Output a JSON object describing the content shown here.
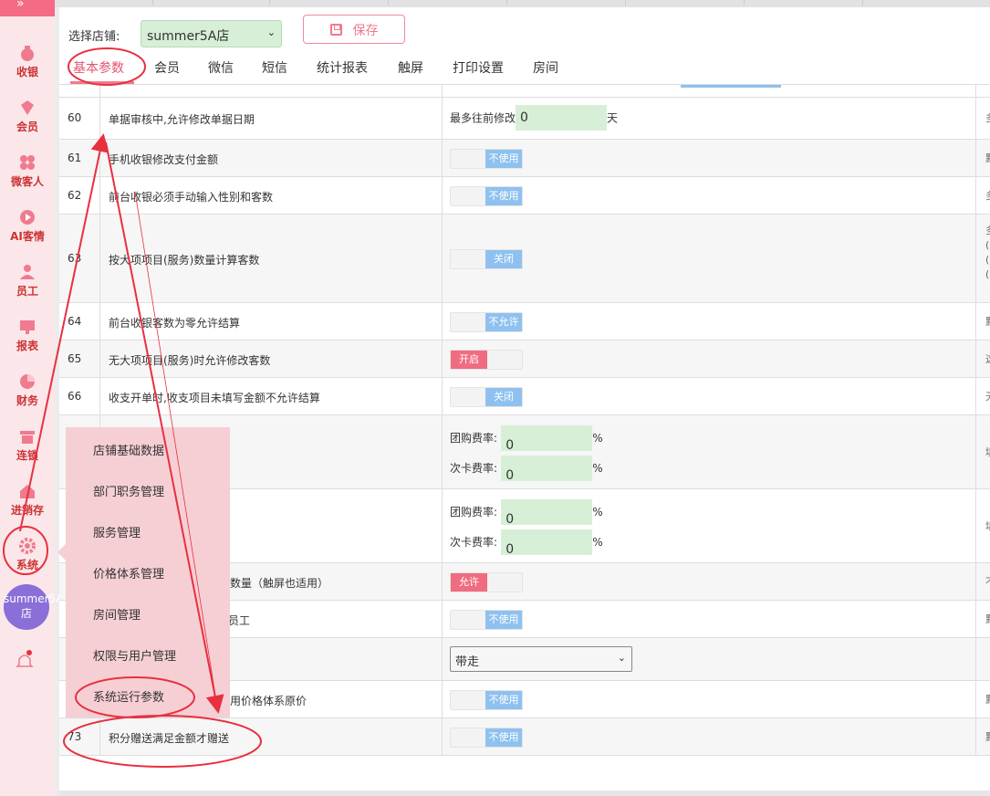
{
  "sidebar": {
    "items": [
      {
        "label": "收银",
        "icon": "money-bag-icon"
      },
      {
        "label": "会员",
        "icon": "diamond-icon"
      },
      {
        "label": "微客人",
        "icon": "grid-icon"
      },
      {
        "label": "AI客情",
        "icon": "play-icon"
      },
      {
        "label": "员工",
        "icon": "person-icon"
      },
      {
        "label": "报表",
        "icon": "monitor-icon"
      },
      {
        "label": "财务",
        "icon": "pie-icon"
      },
      {
        "label": "连锁",
        "icon": "shop-icon"
      },
      {
        "label": "进销存",
        "icon": "house-icon"
      },
      {
        "label": "系统",
        "icon": "gear-icon"
      }
    ],
    "avatar_text": "summer5A店"
  },
  "header": {
    "store_label": "选择店铺:",
    "store_value": "summer5A店",
    "save_label": "保存"
  },
  "tabs": [
    {
      "label": "基本参数",
      "active": true
    },
    {
      "label": "会员"
    },
    {
      "label": "微信"
    },
    {
      "label": "短信"
    },
    {
      "label": "统计报表"
    },
    {
      "label": "触屏"
    },
    {
      "label": "打印设置"
    },
    {
      "label": "房间"
    }
  ],
  "rows": [
    {
      "num": "60",
      "name": "单据审核中,允许修改单据日期",
      "kind": "days",
      "prefix": "最多往前修改",
      "value": "0",
      "suffix": "天",
      "desc": "多"
    },
    {
      "num": "61",
      "name": "手机收银修改支付金额",
      "kind": "toggle",
      "state": "off",
      "label": "不使用",
      "desc": "默"
    },
    {
      "num": "62",
      "name": "前台收银必须手动输入性别和客数",
      "kind": "toggle",
      "state": "off",
      "label": "不使用",
      "desc": "多"
    },
    {
      "num": "63",
      "name": "按大项项目(服务)数量计算客数",
      "kind": "toggle",
      "state": "off",
      "label": "关闭",
      "desc": "多\n(\n(\n("
    },
    {
      "num": "64",
      "name": "前台收银客数为零允许结算",
      "kind": "toggle",
      "state": "off",
      "label": "不允许",
      "desc": "默"
    },
    {
      "num": "65",
      "name": "无大项项目(服务)时允许修改客数",
      "kind": "toggle",
      "state": "on",
      "label": "开启",
      "desc": "这"
    },
    {
      "num": "66",
      "name": "收支开单时,收支项目未填写金额不允许结算",
      "kind": "toggle",
      "state": "off",
      "label": "关闭",
      "desc": "无"
    },
    {
      "num": "",
      "name": "",
      "kind": "rates",
      "rate1_label": "团购费率:",
      "rate1": "0",
      "rate2_label": "次卡费率:",
      "rate2": "0",
      "unit": "%",
      "desc": "填"
    },
    {
      "num": "",
      "name": "",
      "kind": "rates",
      "rate1_label": "团购费率:",
      "rate1": "0",
      "rate2_label": "次卡费率:",
      "rate2": "0",
      "unit": "%",
      "desc": "填"
    },
    {
      "num": "",
      "name": "数量（触屏也适用）",
      "kind": "toggle",
      "state": "on",
      "label": "允许",
      "desc": "不"
    },
    {
      "num": "",
      "name": "员工",
      "kind": "toggle",
      "state": "off",
      "label": "不使用",
      "desc": "默"
    },
    {
      "num": "",
      "name": "",
      "kind": "select",
      "value": "带走",
      "desc": ""
    },
    {
      "num": "",
      "name": "用价格体系原价",
      "kind": "toggle",
      "state": "off",
      "label": "不使用",
      "desc": "默"
    },
    {
      "num": "73",
      "name": "积分赠送满足金额才赠送",
      "kind": "toggle",
      "state": "off",
      "label": "不使用",
      "desc": "默"
    }
  ],
  "system_menu": [
    "店铺基础数据",
    "部门职务管理",
    "服务管理",
    "价格体系管理",
    "房间管理",
    "权限与用户管理",
    "系统运行参数"
  ],
  "colors": {
    "accent": "#f07a8e",
    "toggle_off": "#8ec1ef",
    "toggle_on": "#f06c80",
    "input_bg": "#d6efd6",
    "annotation": "#e8303f",
    "menu_bg": "#f6cfd4"
  }
}
